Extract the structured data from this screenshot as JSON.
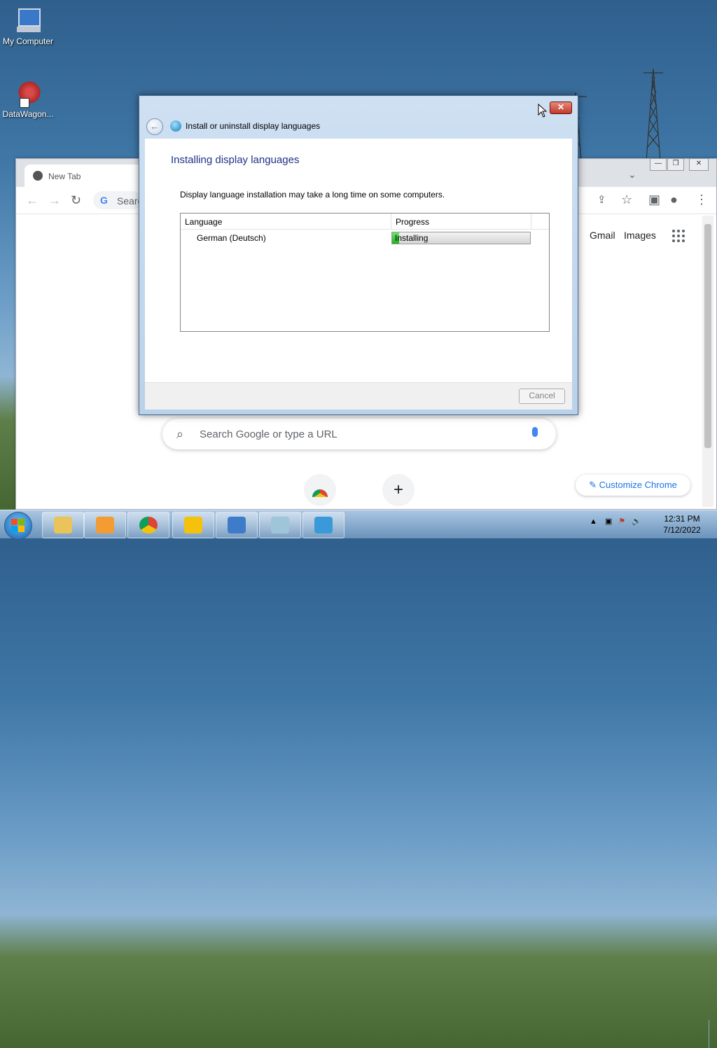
{
  "desktop": {
    "icons": [
      {
        "label": "My Computer"
      },
      {
        "label": "DataWagon..."
      }
    ]
  },
  "chrome": {
    "tab_title": "New Tab",
    "omnibox_text": "Searc",
    "gmail": "Gmail",
    "images": "Images",
    "search_placeholder": "Search Google or type a URL",
    "customize_label": "Customize Chrome",
    "add_shortcut": "+"
  },
  "dialog": {
    "title": "Install or uninstall display languages",
    "heading": "Installing display languages",
    "description": "Display language installation may take a long time on some computers.",
    "columns": [
      "Language",
      "Progress"
    ],
    "rows": [
      {
        "language": "German (Deutsch)",
        "status": "Installing",
        "progress": 0.05
      }
    ],
    "cancel_label": "Cancel",
    "close_glyph": "✕",
    "back_glyph": "←"
  },
  "taskbar": {
    "items": [
      {
        "icon": "file-explorer-icon",
        "color": "#e8c45a"
      },
      {
        "icon": "media-player-icon",
        "color": "#f39c34"
      },
      {
        "icon": "chrome-icon",
        "color": "#db4437"
      },
      {
        "icon": "lock-app-icon",
        "color": "#f4c20d"
      },
      {
        "icon": "control-panel-icon",
        "color": "#3d7cc9"
      },
      {
        "icon": "notepad-icon",
        "color": "#9ec6d8"
      },
      {
        "icon": "language-installer-icon",
        "color": "#3a9ad9"
      }
    ],
    "time": "12:31 PM",
    "date": "7/12/2022"
  }
}
